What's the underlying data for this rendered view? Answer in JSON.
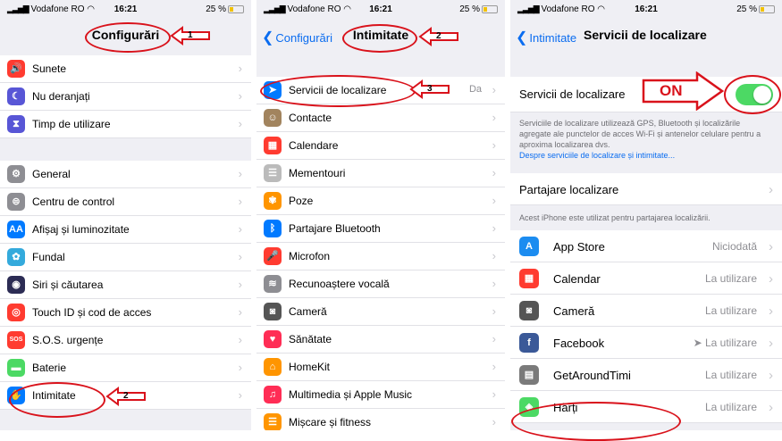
{
  "status": {
    "carrier": "Vodafone RO",
    "time": "16:21",
    "battery": "25 %"
  },
  "screen1": {
    "title": "Configurări",
    "group1": [
      {
        "label": "Sunete",
        "icon": "speaker-icon",
        "color": "#ff3b30",
        "glyph": "🔊"
      },
      {
        "label": "Nu deranjați",
        "icon": "moon-icon",
        "color": "#5856d6",
        "glyph": "☾"
      },
      {
        "label": "Timp de utilizare",
        "icon": "hourglass-icon",
        "color": "#5856d6",
        "glyph": "⧗"
      }
    ],
    "group2": [
      {
        "label": "General",
        "icon": "gear-icon",
        "color": "#8e8e93",
        "glyph": "⚙"
      },
      {
        "label": "Centru de control",
        "icon": "switches-icon",
        "color": "#8e8e93",
        "glyph": "⊜"
      },
      {
        "label": "Afișaj și luminozitate",
        "icon": "display-icon",
        "color": "#007aff",
        "glyph": "AA"
      },
      {
        "label": "Fundal",
        "icon": "wallpaper-icon",
        "color": "#34aadc",
        "glyph": "✿"
      },
      {
        "label": "Siri și căutarea",
        "icon": "siri-icon",
        "color": "#2c2c54",
        "glyph": "◉"
      },
      {
        "label": "Touch ID și cod de acces",
        "icon": "fingerprint-icon",
        "color": "#ff3b30",
        "glyph": "◎"
      },
      {
        "label": "S.O.S. urgențe",
        "icon": "sos-icon",
        "color": "#ff3b30",
        "glyph": "SOS"
      },
      {
        "label": "Baterie",
        "icon": "battery-icon",
        "color": "#4cd964",
        "glyph": "▬"
      },
      {
        "label": "Intimitate",
        "icon": "hand-icon",
        "color": "#007aff",
        "glyph": "✋"
      }
    ]
  },
  "screen2": {
    "back": "Configurări",
    "title": "Intimitate",
    "rows": [
      {
        "label": "Servicii de localizare",
        "icon": "location-arrow-icon",
        "color": "#007aff",
        "glyph": "➤",
        "value": "Da"
      },
      {
        "label": "Contacte",
        "icon": "contacts-icon",
        "color": "#a2845e",
        "glyph": "☺",
        "value": ""
      },
      {
        "label": "Calendare",
        "icon": "calendar-icon",
        "color": "#ff3b30",
        "glyph": "▦",
        "value": ""
      },
      {
        "label": "Mementouri",
        "icon": "reminders-icon",
        "color": "#bbbbbb",
        "glyph": "☰",
        "value": ""
      },
      {
        "label": "Poze",
        "icon": "photos-icon",
        "color": "#ff9500",
        "glyph": "✾",
        "value": ""
      },
      {
        "label": "Partajare Bluetooth",
        "icon": "bluetooth-icon",
        "color": "#007aff",
        "glyph": "ᛒ",
        "value": ""
      },
      {
        "label": "Microfon",
        "icon": "microphone-icon",
        "color": "#ff3b30",
        "glyph": "🎤",
        "value": ""
      },
      {
        "label": "Recunoaștere vocală",
        "icon": "waveform-icon",
        "color": "#8e8e93",
        "glyph": "≋",
        "value": ""
      },
      {
        "label": "Cameră",
        "icon": "camera-icon",
        "color": "#555555",
        "glyph": "◙",
        "value": ""
      },
      {
        "label": "Sănătate",
        "icon": "heart-icon",
        "color": "#ff2d55",
        "glyph": "♥",
        "value": ""
      },
      {
        "label": "HomeKit",
        "icon": "home-icon",
        "color": "#ff9500",
        "glyph": "⌂",
        "value": ""
      },
      {
        "label": "Multimedia și Apple Music",
        "icon": "music-icon",
        "color": "#ff2d55",
        "glyph": "♫",
        "value": ""
      },
      {
        "label": "Mișcare și fitness",
        "icon": "fitness-icon",
        "color": "#ff9500",
        "glyph": "☰",
        "value": ""
      }
    ]
  },
  "screen3": {
    "back": "Intimitate",
    "title": "Servicii de localizare",
    "toggle_label": "Servicii de localizare",
    "toggle_on": true,
    "desc": "Serviciile de localizare utilizează GPS, Bluetooth și localizările agregate ale punctelor de acces Wi-Fi și antenelor celulare pentru a aproxima localizarea dvs.",
    "desc_link": "Despre serviciile de localizare și intimitate...",
    "share_label": "Partajare localizare",
    "share_note": "Acest iPhone este utilizat pentru partajarea localizării.",
    "apps": [
      {
        "label": "App Store",
        "icon": "app-store-icon",
        "color": "#1c8cf0",
        "glyph": "A",
        "value": "Niciodată"
      },
      {
        "label": "Calendar",
        "icon": "calendar-icon",
        "color": "#ff3b30",
        "glyph": "▦",
        "value": "La utilizare"
      },
      {
        "label": "Cameră",
        "icon": "camera-icon",
        "color": "#555555",
        "glyph": "◙",
        "value": "La utilizare"
      },
      {
        "label": "Facebook",
        "icon": "facebook-icon",
        "color": "#3b5998",
        "glyph": "f",
        "value": "➤ La utilizare"
      },
      {
        "label": "GetAroundTimi",
        "icon": "bus-icon",
        "color": "#7a7a7a",
        "glyph": "▤",
        "value": "La utilizare"
      },
      {
        "label": "Hărți",
        "icon": "maps-icon",
        "color": "#4cd964",
        "glyph": "◈",
        "value": "La utilizare"
      }
    ]
  },
  "annotations": {
    "step1": "1",
    "step2a": "2",
    "step2b": "2",
    "step3": "3",
    "on": "ON"
  },
  "colors": {
    "accent": "#0a6cf0",
    "annotation": "#d9121b",
    "toggle": "#4cd964"
  }
}
